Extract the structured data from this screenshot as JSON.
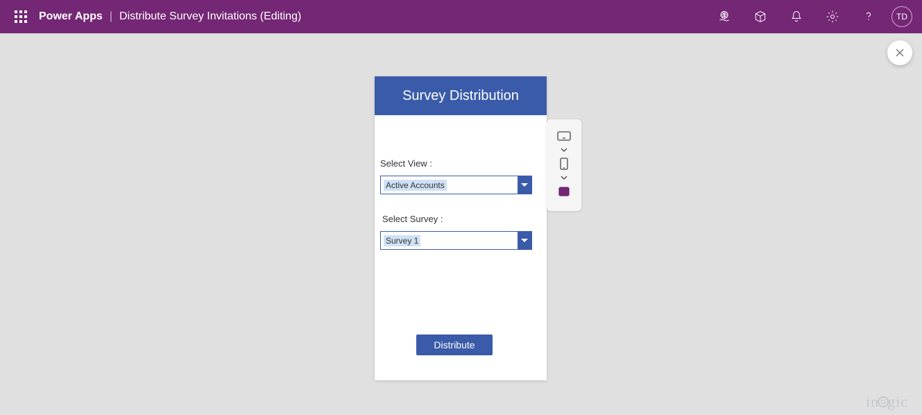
{
  "header": {
    "app_name": "Power Apps",
    "page_title": "Distribute Survey Invitations (Editing)",
    "avatar_initials": "TD"
  },
  "canvas": {
    "title": "Survey Distribution",
    "select_view_label": "Select View :",
    "select_view_value": "Active Accounts",
    "select_survey_label": "Select Survey :",
    "select_survey_value": "Survey 1",
    "distribute_button": "Distribute"
  },
  "watermark": {
    "part1": "in",
    "part2": "gic"
  }
}
